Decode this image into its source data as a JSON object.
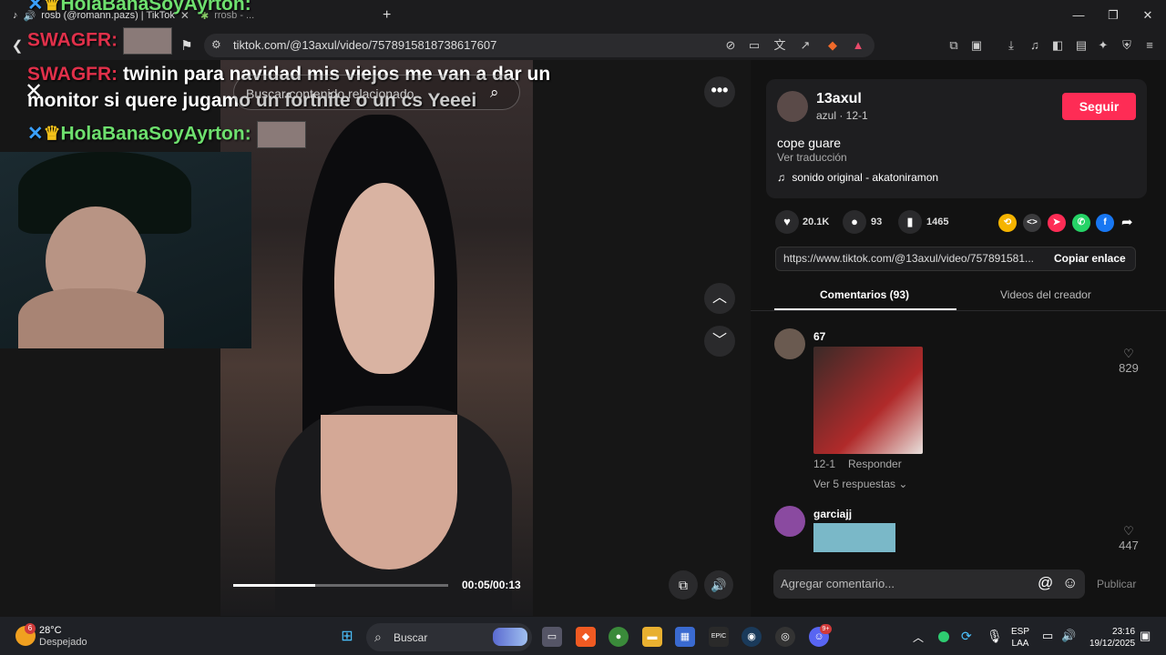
{
  "browser": {
    "tab1_title": "rosb (@romann.pazs) | TikTok",
    "tab2_title": "rrosb - ...",
    "new_tab": "+",
    "url": "tiktok.com/@13axul/video/7578915818738617607"
  },
  "stream_overlay": {
    "line1_name": "HolaBanaSoyAyrton:",
    "line2_name": "SWAGFR:",
    "line3_name": "SWAGFR:",
    "line3_text": "twinin para navidad mis viejos me van a dar un",
    "line4_text": "monitor si quere jugamo un fortnite o un cs Yeeei",
    "line5_name": "HolaBanaSoyAyrton:"
  },
  "video": {
    "search_placeholder": "Buscar contenido relacionado",
    "time": "00:05/00:13",
    "progress": 0.38
  },
  "post": {
    "author": "13axul",
    "author_sub": "azul · 12-1",
    "follow": "Seguir",
    "caption": "cope guare",
    "translate": "Ver traducción",
    "sound": "sonido original - akatoniramon",
    "likes": "20.1K",
    "comments_count": "93",
    "saves": "1465",
    "link": "https://www.tiktok.com/@13axul/video/757891581...",
    "copy_link": "Copiar enlace"
  },
  "tabs": {
    "comments": "Comentarios (93)",
    "videos": "Videos del creador"
  },
  "comments": [
    {
      "user": "67",
      "date": "12-1",
      "reply": "Responder",
      "replies": "Ver 5 respuestas",
      "likes": "829"
    },
    {
      "user": "garciajj",
      "likes": "447"
    }
  ],
  "comment_input": {
    "placeholder": "Agregar comentario...",
    "publish": "Publicar"
  },
  "taskbar": {
    "temp": "28°C",
    "weather": "Despejado",
    "search": "Buscar",
    "lang1": "ESP",
    "lang2": "LAA",
    "time": "23:16",
    "date": "19/12/2025",
    "weather_badge": "6",
    "discord_badge": "9+"
  },
  "colors": {
    "accent": "#fe2c55",
    "chat_red": "#e0304a",
    "chat_green": "#6ee06e"
  }
}
